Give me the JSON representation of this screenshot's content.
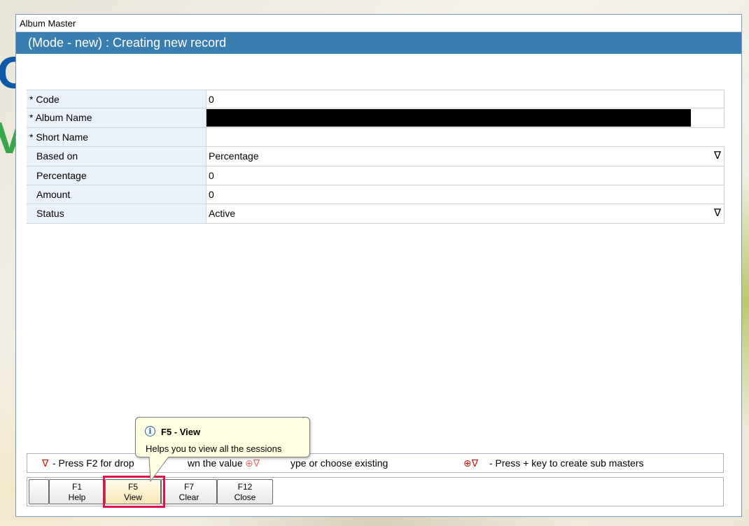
{
  "window": {
    "title": "Album Master"
  },
  "header": {
    "title": "(Mode - new) : Creating new record"
  },
  "form": {
    "rows": [
      {
        "label": "* Code",
        "value": "0"
      },
      {
        "label": "* Album Name",
        "value": ""
      },
      {
        "label": "* Short Name",
        "value": ""
      },
      {
        "label": "Based on",
        "value": "Percentage",
        "dropdown_icon": "∇"
      },
      {
        "label": "Percentage",
        "value": "0"
      },
      {
        "label": "Amount",
        "value": "0"
      },
      {
        "label": "Status",
        "value": "Active",
        "dropdown_icon": "∇"
      }
    ]
  },
  "legend": {
    "item1_symbol": "∇",
    "item1_text": "- Press F2 for drop",
    "item1_text_tail": "wn the value",
    "item2_symbol": "⊕∇",
    "item2_text": "ype or choose existing",
    "item3_symbol": "⊕∇",
    "item3_text": "- Press + key to create sub masters"
  },
  "fkeys": [
    {
      "key": "F1",
      "label": "Help"
    },
    {
      "key": "F5",
      "label": "View"
    },
    {
      "key": "F7",
      "label": "Clear"
    },
    {
      "key": "F12",
      "label": "Close"
    }
  ],
  "tooltip": {
    "icon": "info-icon",
    "title": "F5 - View",
    "text": "Helps you to view all the sessions"
  },
  "colors": {
    "header_bg": "#3a7db0",
    "label_bg": "#eaf1f8",
    "highlight": "#e0124a",
    "legend_symbol": "#d11a1a",
    "tooltip_bg": "#ffffe1"
  }
}
